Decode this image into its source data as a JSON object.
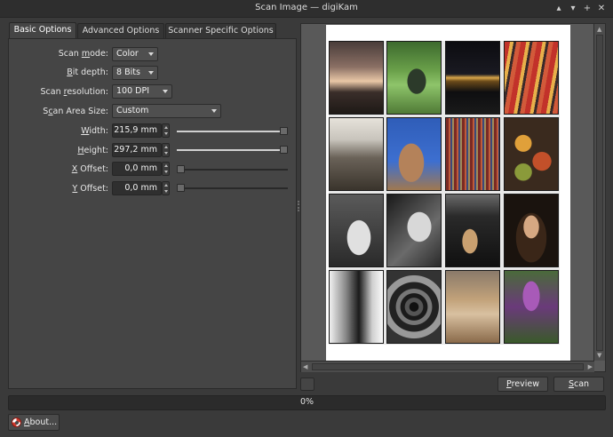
{
  "window": {
    "title": "Scan Image — digiKam",
    "buttons": {
      "keep_above": "▴",
      "minimize": "▾",
      "maximize": "+",
      "close": "✕"
    }
  },
  "tabs": [
    {
      "label": "Basic Options",
      "active": true
    },
    {
      "label": "Advanced Options",
      "active": false
    },
    {
      "label": "Scanner Specific Options",
      "active": false
    }
  ],
  "options": {
    "scan_mode": {
      "label_pre": "Scan ",
      "label_u": "m",
      "label_post": "ode:",
      "value": "Color"
    },
    "bit_depth": {
      "label_pre": "",
      "label_u": "B",
      "label_post": "it depth:",
      "value": "8 Bits"
    },
    "scan_resolution": {
      "label_pre": "Scan ",
      "label_u": "r",
      "label_post": "esolution:",
      "value": "100 DPI"
    },
    "scan_area_size": {
      "label_pre": "S",
      "label_u": "c",
      "label_post": "an Area Size:",
      "value": "Custom"
    },
    "width": {
      "label_pre": "",
      "label_u": "W",
      "label_post": "idth:",
      "value": "215,9 mm",
      "slider_fraction": 1.0
    },
    "height": {
      "label_pre": "",
      "label_u": "H",
      "label_post": "eight:",
      "value": "297,2 mm",
      "slider_fraction": 1.0
    },
    "x_offset": {
      "label_pre": "",
      "label_u": "X",
      "label_post": " Offset:",
      "value": "0,0 mm",
      "slider_fraction": 0.0
    },
    "y_offset": {
      "label_pre": "",
      "label_u": "Y",
      "label_post": " Offset:",
      "value": "0,0 mm",
      "slider_fraction": 0.0
    }
  },
  "actions": {
    "preview_pre": "",
    "preview_u": "P",
    "preview_post": "review",
    "scan_pre": "",
    "scan_u": "S",
    "scan_post": "can"
  },
  "progress": {
    "value": 0,
    "text": "0%"
  },
  "about": {
    "pre": "",
    "u": "A",
    "post": "bout..."
  },
  "icons": {
    "about": "lifebuoy-icon"
  }
}
